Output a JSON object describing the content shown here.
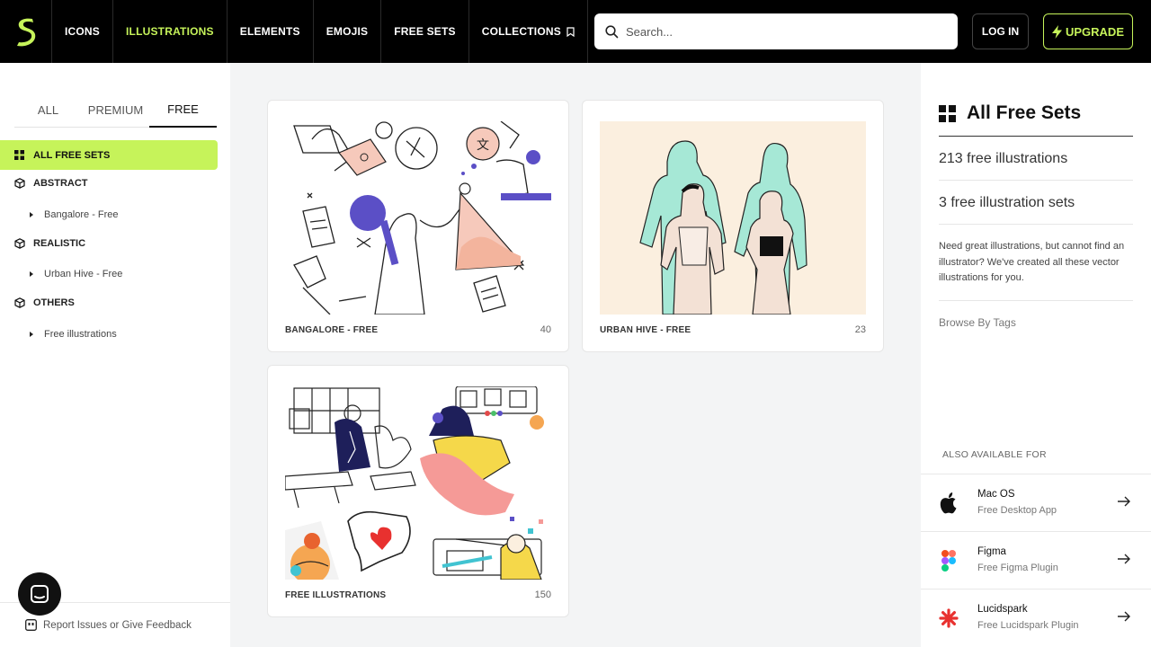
{
  "header": {
    "logo": "lightning-s-logo",
    "nav": [
      {
        "label": "ICONS",
        "active": false
      },
      {
        "label": "ILLUSTRATIONS",
        "active": true
      },
      {
        "label": "ELEMENTS",
        "active": false
      },
      {
        "label": "EMOJIS",
        "active": false
      },
      {
        "label": "FREE SETS",
        "active": false
      },
      {
        "label": "COLLECTIONS",
        "active": false
      }
    ],
    "search_placeholder": "Search...",
    "login_label": "LOG IN",
    "upgrade_label": "UPGRADE",
    "accent_color": "#c6f35a"
  },
  "sidebar": {
    "tabs": [
      {
        "label": "ALL",
        "active": false
      },
      {
        "label": "PREMIUM",
        "active": false
      },
      {
        "label": "FREE",
        "active": true
      }
    ],
    "categories": [
      {
        "label": "ALL FREE SETS",
        "icon": "grid-icon",
        "active": true
      },
      {
        "label": "ABSTRACT",
        "icon": "cube-icon",
        "children": [
          "Bangalore - Free"
        ]
      },
      {
        "label": "REALISTIC",
        "icon": "cube-icon",
        "children": [
          "Urban Hive - Free"
        ]
      },
      {
        "label": "OTHERS",
        "icon": "cube-icon",
        "children": [
          "Free illustrations"
        ]
      }
    ],
    "feedback_label": "Report Issues or Give Feedback"
  },
  "cards": [
    {
      "title": "BANGALORE - FREE",
      "count": "40"
    },
    {
      "title": "URBAN HIVE - FREE",
      "count": "23"
    },
    {
      "title": "FREE ILLUSTRATIONS",
      "count": "150"
    }
  ],
  "right_panel": {
    "title": "All Free Sets",
    "stat_illustrations": "213 free illustrations",
    "stat_sets": "3 free illustration sets",
    "description": "Need great illustrations, but cannot find an illustrator? We've created all these vector illustrations for you.",
    "browse_tags": "Browse By Tags",
    "also_available": "ALSO AVAILABLE FOR",
    "apps": [
      {
        "name": "Mac OS",
        "sub": "Free Desktop App",
        "icon": "apple-icon"
      },
      {
        "name": "Figma",
        "sub": "Free Figma Plugin",
        "icon": "figma-icon"
      },
      {
        "name": "Lucidspark",
        "sub": "Free Lucidspark Plugin",
        "icon": "lucidspark-icon"
      }
    ]
  }
}
